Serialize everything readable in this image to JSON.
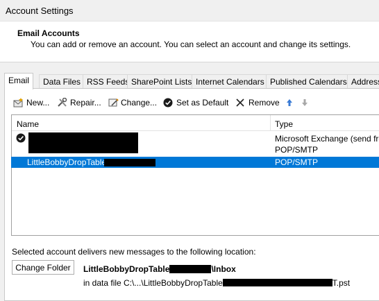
{
  "window": {
    "title": "Account Settings"
  },
  "header": {
    "title": "Email Accounts",
    "subtitle": "You can add or remove an account. You can select an account and change its settings."
  },
  "tabs": [
    {
      "label": "Email",
      "active": true
    },
    {
      "label": "Data Files"
    },
    {
      "label": "RSS Feeds"
    },
    {
      "label": "SharePoint Lists"
    },
    {
      "label": "Internet Calendars"
    },
    {
      "label": "Published Calendars"
    },
    {
      "label": "Address Books"
    }
  ],
  "toolbar": {
    "new": "New...",
    "repair": "Repair...",
    "change": "Change...",
    "set_default": "Set as Default",
    "remove": "Remove"
  },
  "list": {
    "columns": {
      "name": "Name",
      "type": "Type"
    },
    "rows": [
      {
        "name": "",
        "type": "Microsoft Exchange (send from this account by default)",
        "default": true
      },
      {
        "name": "",
        "type": "POP/SMTP"
      },
      {
        "name": "LittleBobbyDropTable",
        "type": "POP/SMTP",
        "selected": true
      }
    ]
  },
  "delivery": {
    "label": "Selected account delivers new messages to the following location:",
    "change_folder": "Change Folder",
    "location_prefix": "LittleBobbyDropTable",
    "location_suffix": "\\Inbox",
    "file_prefix": "in data file C:\\...\\LittleBobbyDropTable",
    "file_suffix": "T.pst"
  },
  "colors": {
    "selection": "#0078d7",
    "accent_arrow": "#3a7bd5"
  }
}
